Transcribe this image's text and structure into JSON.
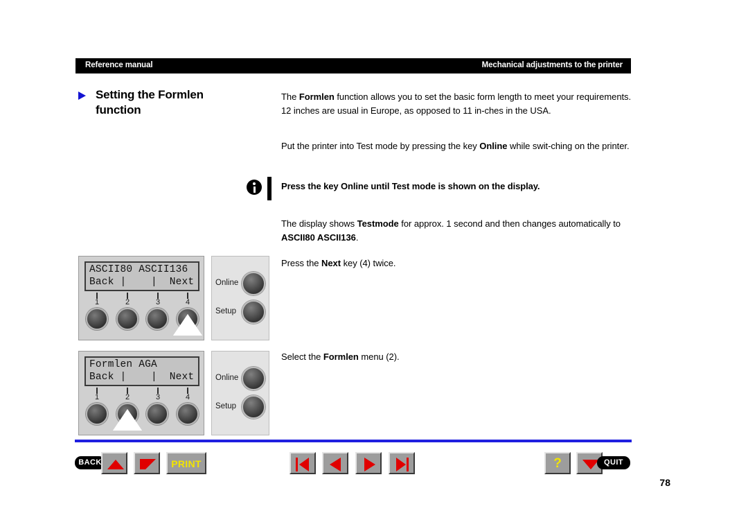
{
  "header": {
    "left_text": "Reference manual",
    "right_text": "Mechanical adjustments to the printer",
    "background": "#000000",
    "text_color": "#ffffff"
  },
  "section": {
    "title_line_1": "Setting the Formlen",
    "title_line_2": "function",
    "marker_icon": "triangle-right-icon",
    "marker_color": "#1414d2"
  },
  "body": {
    "paragraph_1": {
      "part_1": "The ",
      "bold_1": "Formlen",
      "part_2": " function allows you to set the basic form length to meet your requirements. 12 inches are usual in Europe, as opposed to 11 in-ches in the USA."
    },
    "paragraph_2": {
      "part_1": "Put the printer into Test mode by pressing the key ",
      "bold_1": "Online",
      "part_2": " while swit-ching on the printer."
    },
    "note": {
      "icon": "info-circle-icon",
      "text": "Press the key Online until Test mode is shown on the display."
    },
    "paragraph_3": {
      "part_1": "The display shows ",
      "bold_1": "Testmode",
      "part_2": " for approx. 1 second and then changes automatically to ",
      "bold_2": "ASCII80 ASCII136",
      "part_3": "."
    },
    "paragraph_4": {
      "part_1": "Press the ",
      "bold_1": "Next",
      "part_2": " key (4) twice."
    },
    "paragraph_5": {
      "part_1": "Select the ",
      "bold_1": "Formlen",
      "part_2": " menu (2)."
    }
  },
  "figures": [
    {
      "name": "control-panel-ascii",
      "lcd_line_1": "ASCII80 ASCII136",
      "lcd_line_2": "Back |    |  Next",
      "button_numbers": [
        "1",
        "2",
        "3",
        "4"
      ],
      "selected_button": 4,
      "side_buttons": [
        {
          "label": "Online"
        },
        {
          "label": "Setup"
        }
      ]
    },
    {
      "name": "control-panel-formlen",
      "lcd_line_1": "Formlen AGA",
      "lcd_line_2": "Back |    |  Next",
      "button_numbers": [
        "1",
        "2",
        "3",
        "4"
      ],
      "selected_button": 2,
      "side_buttons": [
        {
          "label": "Online"
        },
        {
          "label": "Setup"
        }
      ]
    }
  ],
  "toolbar": {
    "back_label": "BACK",
    "print_label": "PRINT",
    "quit_label": "QUIT",
    "help_label": "?",
    "icons": {
      "scroll_up": "triangle-up-icon",
      "scroll_page": "triangle-corner-icon",
      "first_page": "first-page-icon",
      "prev_page": "prev-page-icon",
      "next_page": "next-page-icon",
      "last_page": "last-page-icon",
      "scroll_down": "triangle-down-icon"
    },
    "accent_red": "#e00000",
    "accent_yellow": "#f2e400",
    "rule_color": "#1f1fe0"
  },
  "page_number": "78"
}
